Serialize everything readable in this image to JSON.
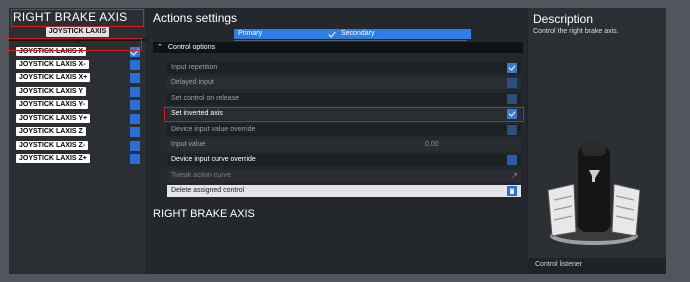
{
  "left": {
    "title": "RIGHT BRAKE AXIS",
    "subtitle": "JOYSTICK LAXIS X",
    "axes": [
      {
        "label": "JOYSTICK LAXIS X",
        "checked": true
      },
      {
        "label": "JOYSTICK LAXIS X-",
        "checked": false
      },
      {
        "label": "JOYSTICK LAXIS X+",
        "checked": false
      },
      {
        "label": "JOYSTICK LAXIS Y",
        "checked": false
      },
      {
        "label": "JOYSTICK LAXIS Y-",
        "checked": false
      },
      {
        "label": "JOYSTICK LAXIS Y+",
        "checked": false
      },
      {
        "label": "JOYSTICK LAXIS Z",
        "checked": false
      },
      {
        "label": "JOYSTICK LAXIS Z-",
        "checked": false
      },
      {
        "label": "JOYSTICK LAXIS Z+",
        "checked": false
      }
    ]
  },
  "main": {
    "title": "Actions settings",
    "tabs": {
      "primary": "Primary",
      "secondary": "Secondary"
    },
    "control_options_header": "Control options",
    "options": {
      "input_repetition": "Input repetition",
      "delayed_input": "Delayed input",
      "set_control_on_release": "Set control on release",
      "set_inverted_axis": "Set inverted axis",
      "device_input_value_override": "Device input value override",
      "input_value": "Input value",
      "input_value_number": "0.00",
      "device_input_curve_override": "Device input curve override",
      "tweak_action_curve": "Tweak action curve",
      "delete_assigned_control": "Delete assigned control"
    },
    "bottom_title": "RIGHT BRAKE AXIS"
  },
  "description": {
    "title": "Description",
    "text": "Control the right brake axis.",
    "listener": "Control listener"
  },
  "colors": {
    "accent": "#2f7ee6",
    "highlight": "#d81c1c"
  }
}
